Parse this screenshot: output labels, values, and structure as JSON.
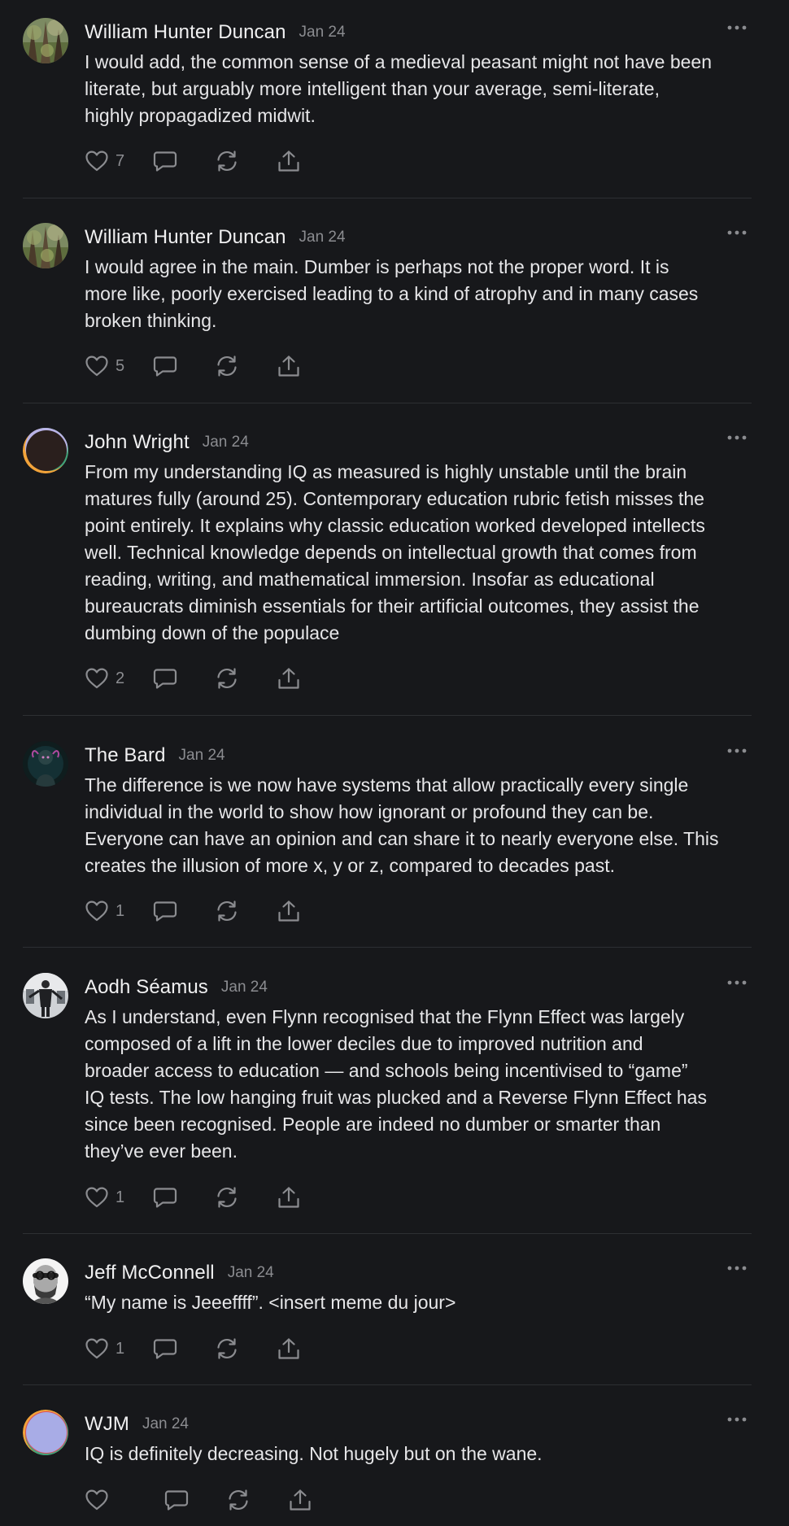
{
  "comments": [
    {
      "author": "William Hunter Duncan",
      "date": "Jan 24",
      "lines": [
        "I would add, the common sense of a medieval peasant might not have been",
        "literate, but arguably more intelligent than your average, semi-literate,",
        "highly propagadized midwit."
      ],
      "likes": "7",
      "avatar": "forest"
    },
    {
      "author": "William Hunter Duncan",
      "date": "Jan 24",
      "lines": [
        "I would agree in the main. Dumber is perhaps not the proper word. It is",
        "more like, poorly exercised leading to a kind of atrophy and in many cases",
        "broken thinking."
      ],
      "likes": "5",
      "avatar": "forest"
    },
    {
      "author": "John Wright",
      "date": "Jan 24",
      "lines": [
        "From my understanding IQ as measured is highly unstable until the brain",
        "matures fully (around 25). Contemporary education rubric fetish misses the",
        "point entirely. It explains why classic education worked developed intellects",
        "well. Technical knowledge depends on intellectual growth that comes from",
        "reading, writing, and mathematical immersion. Insofar as educational",
        "bureaucrats diminish essentials for their artificial outcomes, they assist the",
        "dumbing down of the populace"
      ],
      "likes": "2",
      "avatar": "orb-dark"
    },
    {
      "author": "The Bard",
      "date": "Jan 24",
      "lines": [
        "The difference is we now have systems that allow practically every single",
        "individual in the world to show how ignorant or profound they can be.",
        "Everyone can have an opinion and can share it to nearly everyone else. This",
        "creates the illusion of more x, y or z, compared to decades past."
      ],
      "likes": "1",
      "avatar": "bard"
    },
    {
      "author": "Aodh Séamus",
      "date": "Jan 24",
      "lines": [
        "As I understand, even Flynn recognised that the Flynn Effect was largely",
        "composed of a lift in the lower deciles due to improved nutrition and",
        "broader access to education — and schools being incentivised to “game”",
        "IQ tests. The low hanging fruit was plucked and a Reverse Flynn Effect has",
        "since been recognised. People are indeed no dumber or smarter than",
        "they’ve ever been."
      ],
      "likes": "1",
      "avatar": "figure"
    },
    {
      "author": "Jeff McConnell",
      "date": "Jan 24",
      "lines": [
        "“My name is Jeeeffff”. <insert meme du jour>"
      ],
      "likes": "1",
      "avatar": "bearded"
    },
    {
      "author": "WJM",
      "date": "Jan 24",
      "lines": [
        "IQ is definitely decreasing. Not hugely but on the wane."
      ],
      "likes": "",
      "avatar": "orb-light"
    }
  ],
  "colors": {
    "background": "#17181b",
    "text": "#e6e6e8",
    "muted": "#8b8c90",
    "divider": "#2d2f33"
  },
  "icons": [
    "heart-icon",
    "comment-bubble-icon",
    "restack-icon",
    "share-icon",
    "more-dots-icon"
  ]
}
